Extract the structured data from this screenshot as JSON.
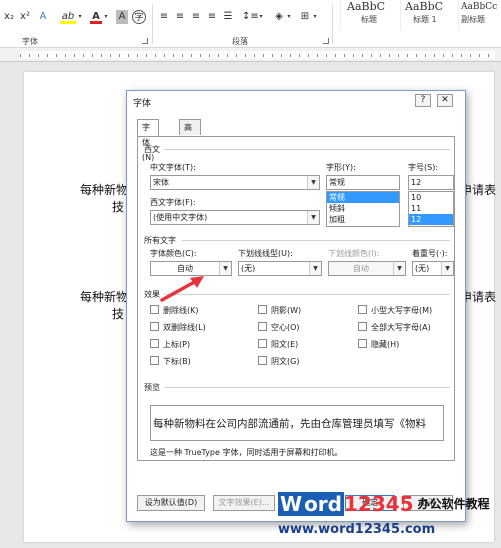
{
  "ribbon": {
    "font_group_label": "字体",
    "paragraph_group_label": "段落",
    "styles": [
      {
        "sample": "AaBbC",
        "name": "标题"
      },
      {
        "sample": "AaBbC",
        "name": "标题 1"
      },
      {
        "sample": "AaBbCc",
        "name": "副标题"
      }
    ],
    "buttons": {
      "subscript": "x₂",
      "superscript": "x²",
      "clear": "A",
      "highlight": "ab",
      "font_color": "A",
      "char_shading": "A",
      "enclose": "字"
    }
  },
  "document": {
    "line1_left": "每种新物",
    "line1_left2": "技",
    "line1_right": "申请表",
    "line2_left": "每种新物",
    "line2_left2": "技",
    "line2_right": "申请表"
  },
  "dialog": {
    "title": "字体",
    "help_btn": "?",
    "close_btn": "✕",
    "tabs": [
      {
        "label": "字体(N)",
        "active": true
      },
      {
        "label": "高级(V)",
        "active": false
      }
    ],
    "western_section": "西文",
    "chinese_font_label": "中文字体(T):",
    "chinese_font_value": "宋体",
    "western_font_label": "西文字体(F):",
    "western_font_value": "(使用中文字体)",
    "style_label": "字形(Y):",
    "style_value": "常规",
    "style_options": [
      "常规",
      "倾斜",
      "加粗"
    ],
    "style_selected": "常规",
    "size_label": "字号(S):",
    "size_value": "12",
    "size_options": [
      "10",
      "11",
      "12"
    ],
    "size_selected": "12",
    "all_text_section": "所有文字",
    "font_color_label": "字体颜色(C):",
    "font_color_value": "自动",
    "underline_style_label": "下划线线型(U):",
    "underline_style_value": "(无)",
    "underline_color_label": "下划线颜色(I):",
    "underline_color_value": "自动",
    "emphasis_label": "着重号(·):",
    "emphasis_value": "(无)",
    "effects_section": "效果",
    "effects": [
      {
        "label": "删除线(K)",
        "checked": false
      },
      {
        "label": "阴影(W)",
        "checked": false
      },
      {
        "label": "小型大写字母(M)",
        "checked": false
      },
      {
        "label": "双删除线(L)",
        "checked": false
      },
      {
        "label": "空心(O)",
        "checked": false
      },
      {
        "label": "全部大写字母(A)",
        "checked": false
      },
      {
        "label": "上标(P)",
        "checked": false
      },
      {
        "label": "阳文(E)",
        "checked": false
      },
      {
        "label": "隐藏(H)",
        "checked": false
      },
      {
        "label": "下标(B)",
        "checked": false
      },
      {
        "label": "阴文(G)",
        "checked": false
      }
    ],
    "preview_section": "预览",
    "preview_text": "每种新物料在公司内部流通前，先由仓库管理员填写《物料",
    "preview_note": "这是一种 TrueType 字体，同时适用于屏幕和打印机。",
    "set_default_btn": "设为默认值(D)",
    "text_effects_btn": "文字效果(E)...",
    "ok_btn": "确定",
    "cancel_btn": "取消"
  },
  "watermark": {
    "logo_w": "W",
    "logo_word": "ord",
    "logo_num": "12345",
    "logo_cn": "办公软件教程",
    "url": "www.word12345.com"
  },
  "colors": {
    "font_color_underline": "#e02020",
    "highlight": "#ffff00",
    "arrow": "#e8323c",
    "selection": "#3399ff",
    "brand_blue": "#1a5fb4"
  }
}
